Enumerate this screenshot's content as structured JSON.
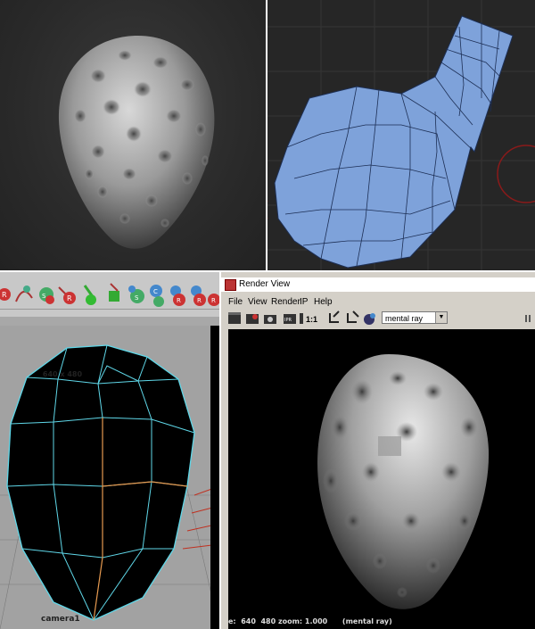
{
  "maya": {
    "resolution_label": "640 x 480",
    "camera_label": "camera1",
    "shelf_icons": [
      "render-icon",
      "curve-tool-icon",
      "sphere-r-icon",
      "sphere-s-icon",
      "render-r-icon",
      "paint-brush-icon",
      "paint-bucket-icon",
      "sphere-s2-icon",
      "sphere-c-icon",
      "sphere-c2-icon",
      "render-r2-icon",
      "render-r3-icon",
      "render-r4-icon"
    ]
  },
  "render_view": {
    "title": "Render View",
    "menu": [
      "File",
      "View",
      "Render",
      "IPR",
      "Help"
    ],
    "renderer": "mental ray",
    "status": "e:  640  480 zoom: 1.000      (mental ray)",
    "ratio_label": "1:1"
  },
  "colors": {
    "topology_fill": "#7ea2da",
    "topology_edge": "#1d2f55",
    "wireframe": "#5fd7e8",
    "wire_selected": "#e69a50"
  }
}
